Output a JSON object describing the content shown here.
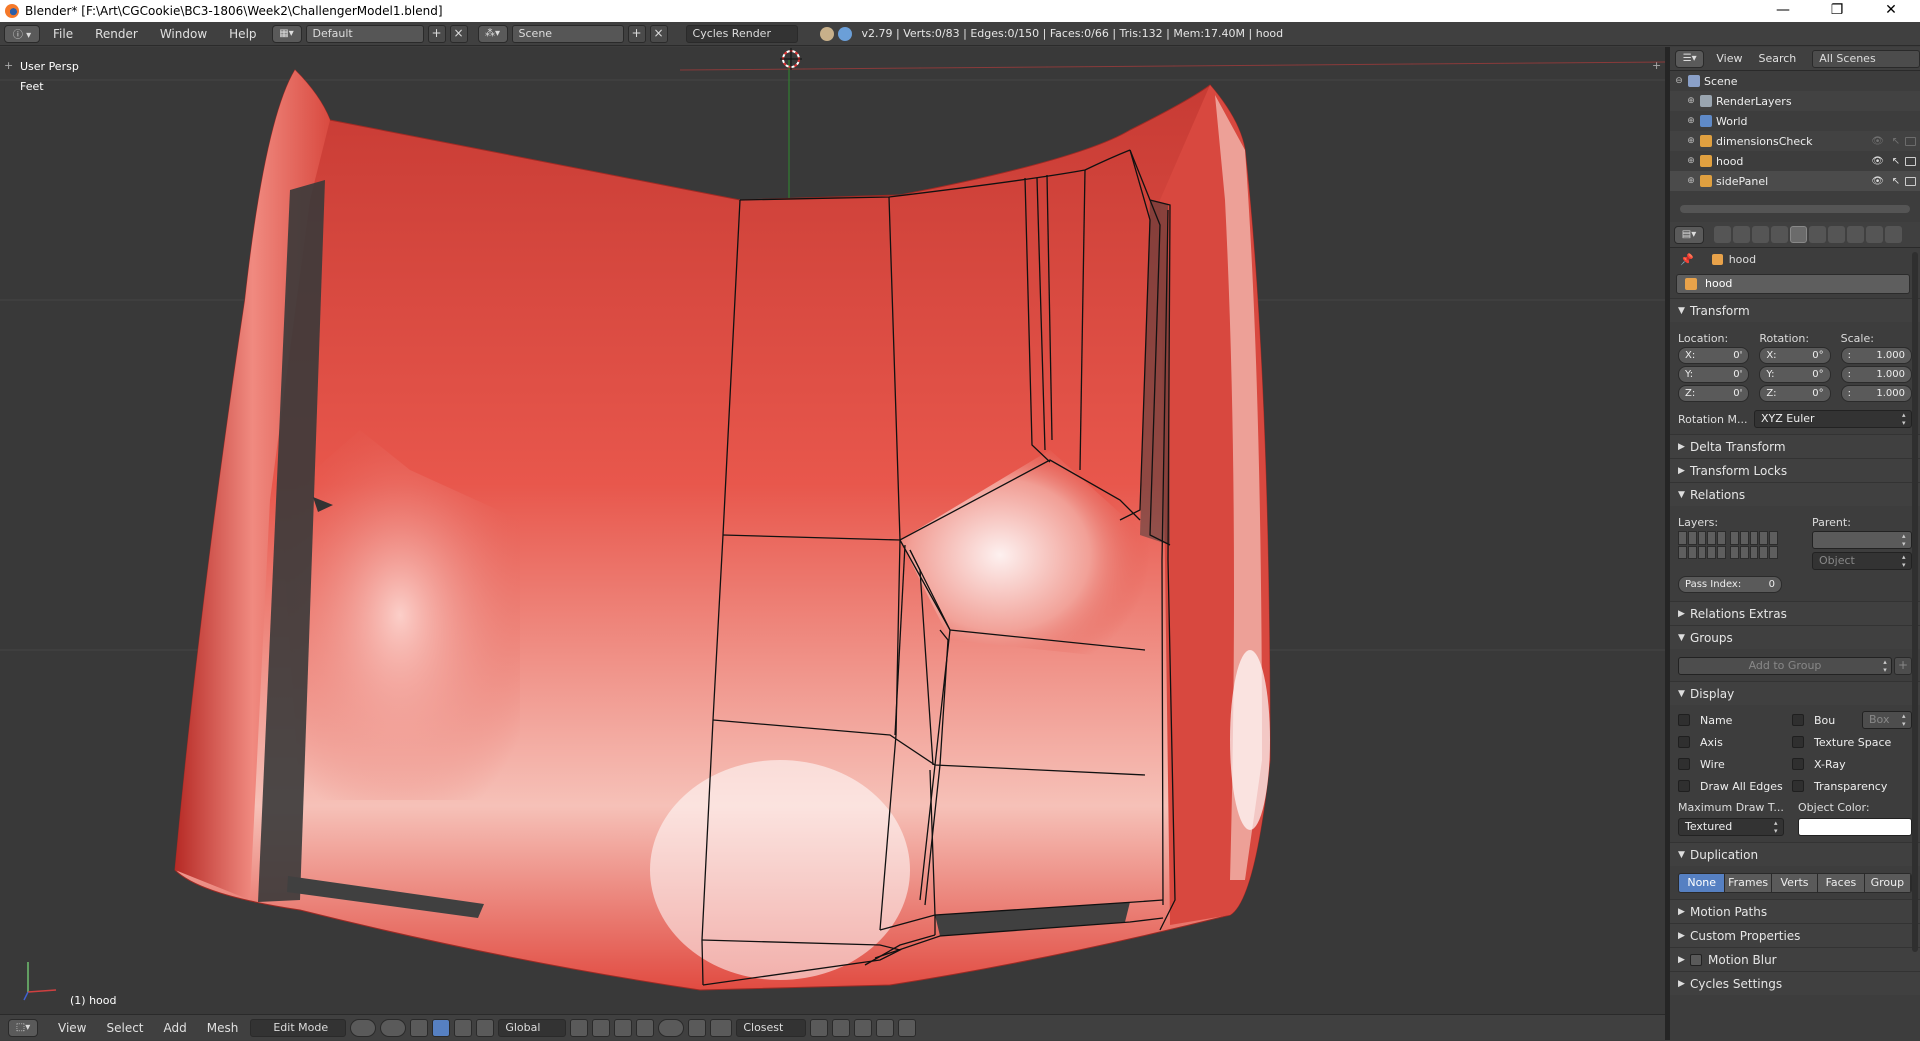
{
  "titlebar": {
    "title": "Blender* [F:\\Art\\CGCookie\\BC3-1806\\Week2\\ChallengerModel1.blend]",
    "minimize": "—",
    "maximize": "❐",
    "close": "✕"
  },
  "info_header": {
    "menus": [
      "File",
      "Render",
      "Window",
      "Help"
    ],
    "screen_layout": "Default",
    "scene": "Scene",
    "render_engine": "Cycles Render",
    "stats": "v2.79 | Verts:0/83 | Edges:0/150 | Faces:0/66 | Tris:132 | Mem:17.40M | hood"
  },
  "viewport": {
    "view_name": "User Persp",
    "units": "Feet",
    "object_info": "(1) hood",
    "hood_color": "#e85a4f",
    "axis_colors": {
      "x": "#d04040",
      "y": "#70c070",
      "z": "#4060d0"
    }
  },
  "view_header": {
    "menus": [
      "View",
      "Select",
      "Add",
      "Mesh"
    ],
    "mode": "Edit Mode",
    "orientation": "Global",
    "snap_target": "Closest"
  },
  "outliner": {
    "menus": [
      "View",
      "Search"
    ],
    "filter": "All Scenes",
    "items": [
      {
        "label": "Scene",
        "indent": 0,
        "icon_color": "#8aa0c8"
      },
      {
        "label": "RenderLayers",
        "indent": 1,
        "icon_color": "#9aa5b0"
      },
      {
        "label": "World",
        "indent": 1,
        "icon_color": "#5f8ac8"
      },
      {
        "label": "dimensionsCheck",
        "indent": 1,
        "icon_color": "#e0a040"
      },
      {
        "label": "hood",
        "indent": 1,
        "icon_color": "#e0a040"
      },
      {
        "label": "sidePanel",
        "indent": 1,
        "icon_color": "#e0a040"
      }
    ]
  },
  "properties": {
    "context_path": "hood",
    "object_name": "hood",
    "transform": {
      "title": "Transform",
      "location_label": "Location:",
      "rotation_label": "Rotation:",
      "scale_label": "Scale:",
      "location": [
        {
          "axis": "X:",
          "value": "0'"
        },
        {
          "axis": "Y:",
          "value": "0'"
        },
        {
          "axis": "Z:",
          "value": "0'"
        }
      ],
      "rotation": [
        {
          "axis": "X:",
          "value": "0°"
        },
        {
          "axis": "Y:",
          "value": "0°"
        },
        {
          "axis": "Z:",
          "value": "0°"
        }
      ],
      "scale": [
        {
          "axis": ":",
          "value": "1.000"
        },
        {
          "axis": ":",
          "value": "1.000"
        },
        {
          "axis": ":",
          "value": "1.000"
        }
      ],
      "rotation_mode_label": "Rotation M...",
      "rotation_mode": "XYZ Euler"
    },
    "panels": {
      "delta_transform": "Delta Transform",
      "transform_locks": "Transform Locks",
      "relations": "Relations",
      "relations_extras": "Relations Extras",
      "groups": "Groups",
      "display": "Display",
      "duplication": "Duplication",
      "motion_paths": "Motion Paths",
      "custom_properties": "Custom Properties",
      "motion_blur": "Motion Blur",
      "cycles_settings": "Cycles Settings"
    },
    "relations": {
      "layers_label": "Layers:",
      "parent_label": "Parent:",
      "parent_type": "Object",
      "pass_index_label": "Pass Index:",
      "pass_index": "0"
    },
    "groups": {
      "add_to_group": "Add to Group"
    },
    "display": {
      "name": "Name",
      "bounds": "Bou",
      "bounds_type": "Box",
      "axis": "Axis",
      "texture_space": "Texture Space",
      "wire": "Wire",
      "xray": "X-Ray",
      "draw_all_edges": "Draw All Edges",
      "transparency": "Transparency",
      "max_draw_type_label": "Maximum Draw T...",
      "max_draw_type": "Textured",
      "object_color_label": "Object Color:",
      "object_color": "#ffffff"
    },
    "duplication": {
      "options": [
        "None",
        "Frames",
        "Verts",
        "Faces",
        "Group"
      ],
      "selected": "None"
    }
  }
}
